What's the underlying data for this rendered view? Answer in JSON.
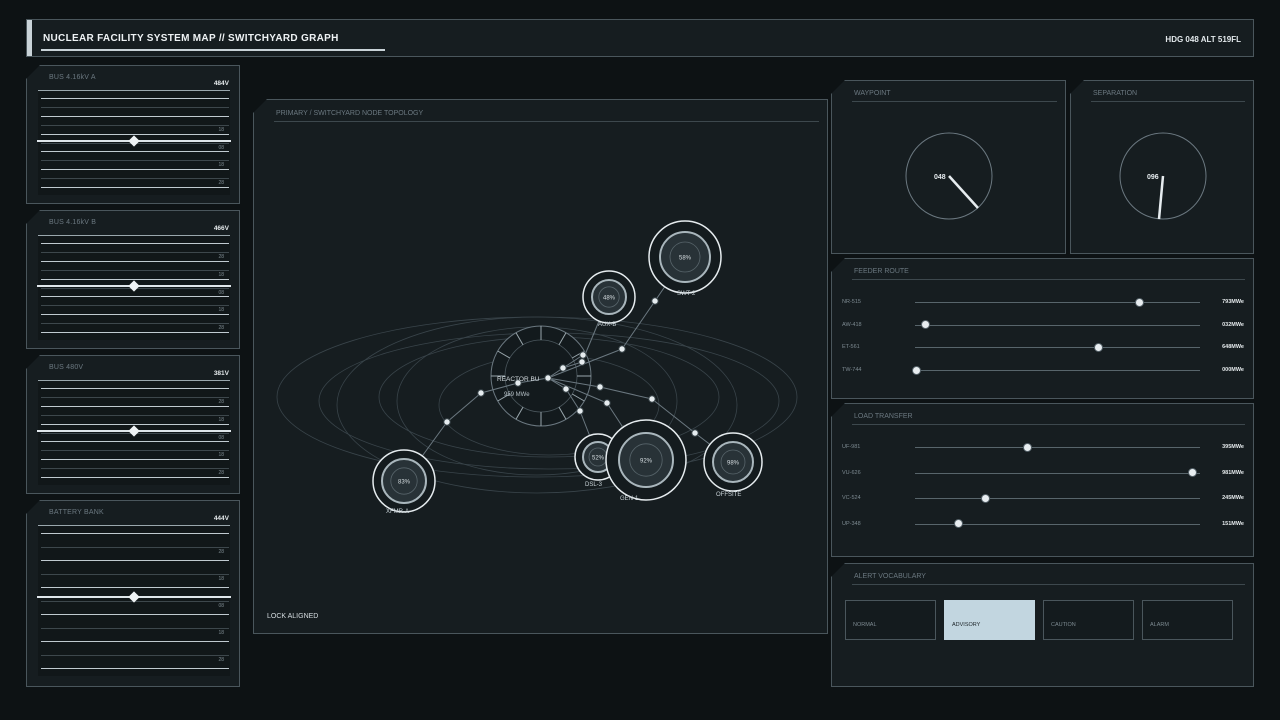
{
  "header": {
    "title": "NUCLEAR FACILITY SYSTEM MAP  //  SWITCHYARD GRAPH",
    "hdg": "HDG 048  ALT 519FL"
  },
  "gauges": [
    {
      "label": "BUS 4.16kV A",
      "value": "484V",
      "ticks": [
        "",
        "18",
        "08",
        "18",
        "28"
      ],
      "level": 0.47
    },
    {
      "label": "BUS 4.16kV B",
      "value": "466V",
      "ticks": [
        "28",
        "18",
        "08",
        "18",
        "28"
      ],
      "level": 0.47
    },
    {
      "label": "BUS 480V",
      "value": "381V",
      "ticks": [
        "28",
        "18",
        "08",
        "18",
        "28"
      ],
      "level": 0.47
    },
    {
      "label": "BATTERY BANK",
      "value": "444V",
      "ticks": [
        "28",
        "18",
        "08",
        "18",
        "28"
      ],
      "level": 0.47
    }
  ],
  "graph": {
    "label": "PRIMARY / SWITCHYARD NODE TOPOLOGY",
    "status": "LOCK ALIGNED",
    "hub": {
      "name": "REACTOR BU",
      "value": "959 MWe"
    },
    "nodes": [
      {
        "name": "SWT-2",
        "pct": "58%"
      },
      {
        "name": "AUX-B",
        "pct": "48%"
      },
      {
        "name": "XFMR-A",
        "pct": "83%"
      },
      {
        "name": "DSL-3",
        "pct": "52%"
      },
      {
        "name": "GEN-1",
        "pct": "92%"
      },
      {
        "name": "OFFSITE",
        "pct": "98%"
      }
    ]
  },
  "waypoint": {
    "label": "WAYPOINT",
    "value": "048"
  },
  "separation": {
    "label": "SEPARATION",
    "value": "096"
  },
  "feeder": {
    "label": "FEEDER ROUTE",
    "rows": [
      {
        "name": "NR-515",
        "value": "793MWe",
        "level": 0.793
      },
      {
        "name": "AW-418",
        "value": "032MWe",
        "level": 0.032
      },
      {
        "name": "ET-561",
        "value": "648MWe",
        "level": 0.648
      },
      {
        "name": "TW-744",
        "value": "000MWe",
        "level": 0.0
      }
    ]
  },
  "transfer": {
    "label": "LOAD TRANSFER",
    "rows": [
      {
        "name": "UF-981",
        "value": "395MWe",
        "level": 0.395
      },
      {
        "name": "VU-626",
        "value": "981MWe",
        "level": 0.981
      },
      {
        "name": "VC-524",
        "value": "245MWe",
        "level": 0.245
      },
      {
        "name": "UP-348",
        "value": "151MWe",
        "level": 0.151
      }
    ]
  },
  "alerts": {
    "label": "ALERT VOCABULARY",
    "items": [
      {
        "label": "NORMAL",
        "active": false
      },
      {
        "label": "ADVISORY",
        "active": true
      },
      {
        "label": "CAUTION",
        "active": false
      },
      {
        "label": "ALARM",
        "active": false
      }
    ]
  },
  "colors": {
    "bg": "#0d1214",
    "panel": "#161d20",
    "border": "#4a565c",
    "accent": "#c2d6e0"
  }
}
